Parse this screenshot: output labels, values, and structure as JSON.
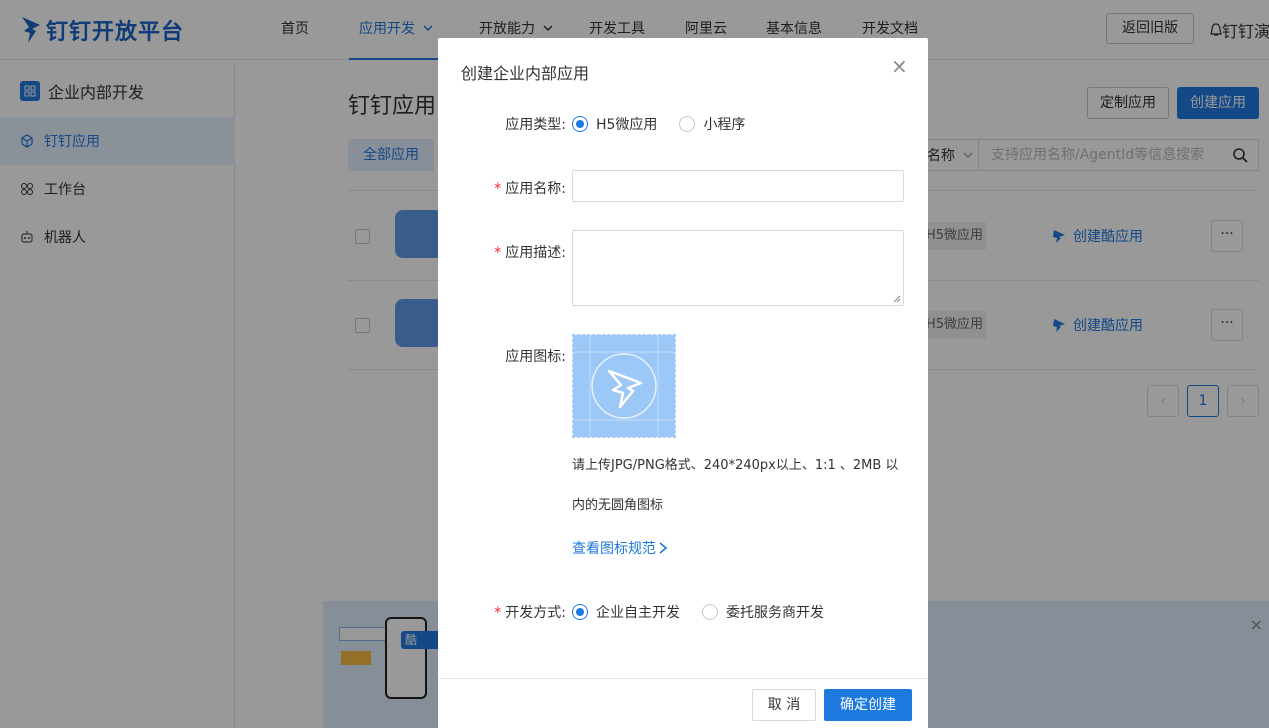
{
  "app": {
    "brand": "钉钉开放平台",
    "brand_color": "#1a63c7",
    "accent_color": "#1f7ae0"
  },
  "nav": {
    "items": [
      {
        "label": "首页",
        "active": false
      },
      {
        "label": "应用开发",
        "active": true,
        "dropdown": true
      },
      {
        "label": "开放能力",
        "active": false,
        "dropdown": true
      },
      {
        "label": "开发工具",
        "active": false
      },
      {
        "label": "阿里云",
        "active": false
      },
      {
        "label": "基本信息",
        "active": false
      },
      {
        "label": "开发文档",
        "active": false
      }
    ],
    "old_version_button": "返回旧版",
    "user_label": "钉钉演"
  },
  "sidebar": {
    "title": "企业内部开发",
    "items": [
      {
        "label": "钉钉应用",
        "icon": "cube-icon",
        "active": true
      },
      {
        "label": "工作台",
        "icon": "grid-icon",
        "active": false
      },
      {
        "label": "机器人",
        "icon": "robot-icon",
        "active": false
      }
    ]
  },
  "main": {
    "title": "钉钉应用",
    "custom_button": "定制应用",
    "create_button": "创建应用",
    "tab_all": "全部应用",
    "filter_label": "名称",
    "search_placeholder": "支持应用名称/AgentId等信息搜索",
    "rows": [
      {
        "tag": "H5微应用",
        "cool_link": "创建酷应用",
        "more": "···"
      },
      {
        "tag": "H5微应用",
        "cool_link": "创建酷应用",
        "more": "···"
      }
    ],
    "pagination": {
      "current": "1",
      "prev": "‹",
      "next": "›"
    },
    "promo": {
      "badge": "酷",
      "close": "×"
    }
  },
  "modal": {
    "title": "创建企业内部应用",
    "close": "×",
    "app_type": {
      "label": "应用类型:",
      "options": [
        "H5微应用",
        "小程序"
      ],
      "selected": "H5微应用"
    },
    "app_name": {
      "label": "应用名称:",
      "required": true,
      "value": ""
    },
    "app_desc": {
      "label": "应用描述:",
      "required": true,
      "value": ""
    },
    "app_icon": {
      "label": "应用图标:",
      "hint_line1": "请上传JPG/PNG格式、240*240px以上、1:1 、2MB 以",
      "hint_line2": "内的无圆角图标",
      "spec_link": "查看图标规范"
    },
    "dev_mode": {
      "label": "开发方式:",
      "required": true,
      "options": [
        "企业自主开发",
        "委托服务商开发"
      ],
      "selected": "企业自主开发"
    },
    "cancel_button": "取 消",
    "confirm_button": "确定创建"
  }
}
